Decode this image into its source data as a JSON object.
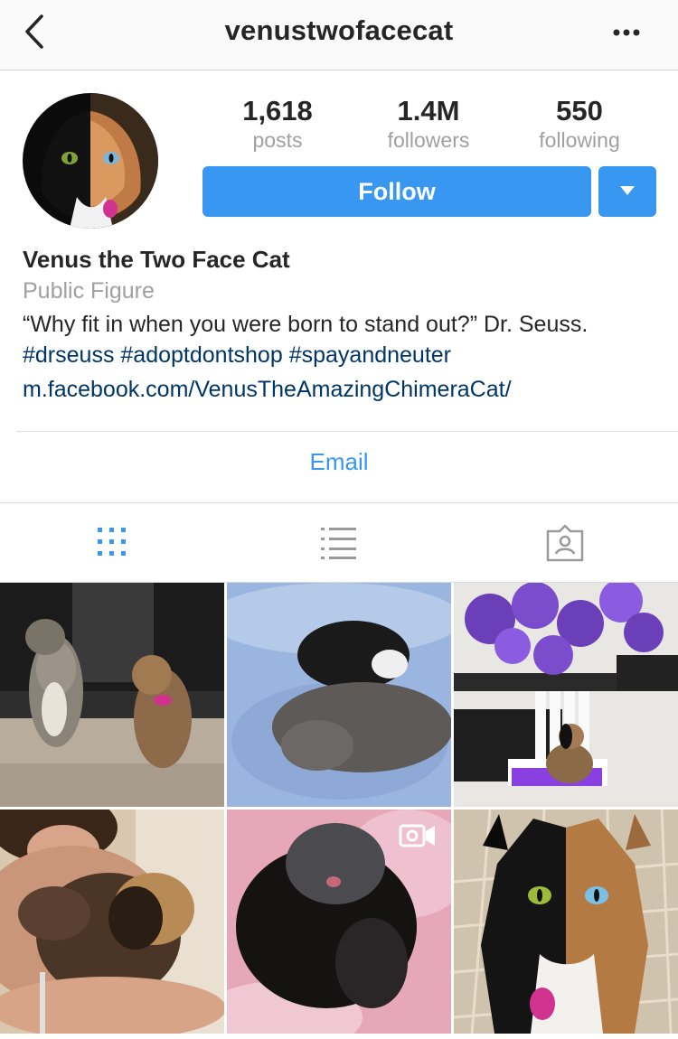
{
  "header": {
    "username": "venustwofacecat",
    "back_icon": "chevron-left-icon",
    "more_icon": "more-horizontal-icon"
  },
  "profile": {
    "stats": {
      "posts": {
        "value": "1,618",
        "label": "posts"
      },
      "followers": {
        "value": "1.4M",
        "label": "followers"
      },
      "following": {
        "value": "550",
        "label": "following"
      }
    },
    "follow_label": "Follow",
    "name": "Venus the Two Face Cat",
    "category": "Public Figure",
    "bio_text": "“Why fit in when you were born to stand out?” Dr. Seuss.",
    "hashtags": [
      "#drseuss",
      "#adoptdontshop",
      "#spayandneuter"
    ],
    "website": "m.facebook.com/VenusTheAmazingChimeraCat/",
    "email_label": "Email"
  },
  "tabs": [
    {
      "name": "grid-view",
      "icon": "grid-icon",
      "active": true
    },
    {
      "name": "list-view",
      "icon": "list-icon",
      "active": false
    },
    {
      "name": "tagged",
      "icon": "tagged-person-icon",
      "active": false
    }
  ],
  "colors": {
    "accent": "#3897f0",
    "link": "#003569",
    "muted": "#a0a0a0",
    "text": "#262626"
  }
}
